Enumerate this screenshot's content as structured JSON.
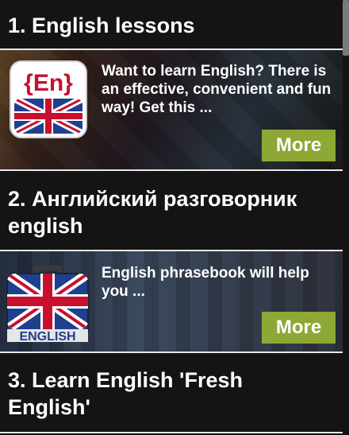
{
  "apps": [
    {
      "title_line1": "1. English lessons",
      "title_line2": "",
      "description": "Want to learn English? There is an effective, convenient and fun way! Get this ...",
      "icon": "en-flag-icon",
      "icon_text": "{En}",
      "more_label": "More"
    },
    {
      "title_line1": "2. Английский разговорник",
      "title_line2": "english",
      "description": "English phrasebook will help you ...",
      "icon": "english-suitcase-icon",
      "icon_text": "ENGLISH",
      "more_label": "More"
    },
    {
      "title_line1": "3. Learn English 'Fresh",
      "title_line2": "English'"
    }
  ],
  "colors": {
    "more_button": "#8ea836",
    "background": "#141414"
  }
}
